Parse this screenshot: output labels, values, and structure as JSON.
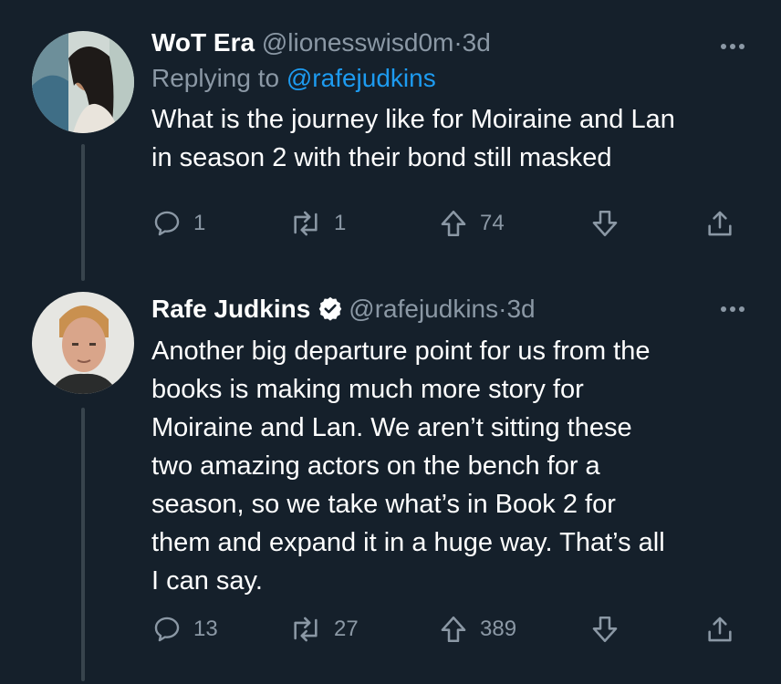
{
  "tweets": [
    {
      "display_name": "WoT Era",
      "handle": "@lionesswisd0m",
      "separator": "·",
      "time": "3d",
      "reply_prefix": "Replying to",
      "reply_mention": "@rafejudkins",
      "text": "What is the journey like for Moiraine and Lan\nin season 2 with their bond still masked",
      "verified": false,
      "counts": {
        "replies": "1",
        "retweets": "1",
        "likes": "74"
      },
      "avatar_icon": "woman-profile-avatar"
    },
    {
      "display_name": "Rafe Judkins",
      "handle": "@rafejudkins",
      "separator": "·",
      "time": "3d",
      "text": "Another big departure point for us from the\nbooks is making much more story for\nMoiraine and Lan.  We aren’t sitting these\ntwo amazing actors on the bench for a\nseason, so we take what’s in Book 2 for\nthem and expand it in a huge way.  That’s all\nI can say.",
      "verified": true,
      "counts": {
        "replies": "13",
        "retweets": "27",
        "likes": "389"
      },
      "avatar_icon": "man-profile-avatar"
    }
  ],
  "icons": {
    "reply": "reply-icon",
    "retweet": "retweet-icon",
    "upvote": "upvote-arrow-icon",
    "downvote": "downvote-arrow-icon",
    "share": "share-icon",
    "more": "more-options-icon",
    "verified": "verified-badge-icon"
  },
  "colors": {
    "background": "#15202b",
    "text_primary": "#ffffff",
    "text_secondary": "#8b98a5",
    "link": "#1d9bf0",
    "thread_line": "#38444d"
  }
}
